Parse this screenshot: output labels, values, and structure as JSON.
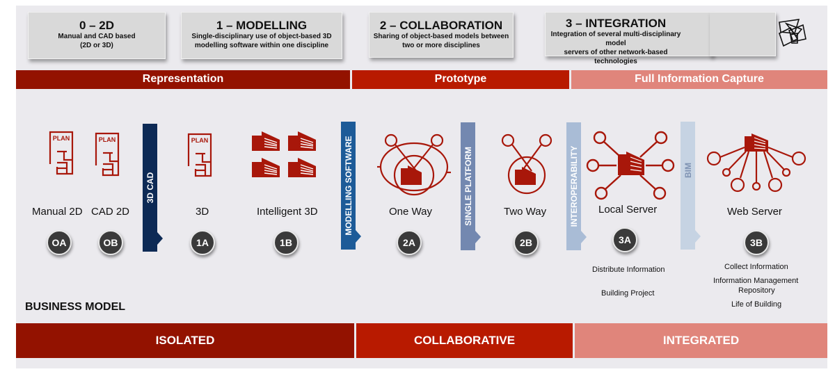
{
  "stages": [
    {
      "title": "0 – 2D",
      "desc1": "Manual and CAD based",
      "desc2": "(2D or 3D)"
    },
    {
      "title": "1 – MODELLING",
      "desc1": "Single-disciplinary use of object-based 3D",
      "desc2": "modelling software within one discipline"
    },
    {
      "title": "2 – COLLABORATION",
      "desc1": "Sharing of object-based models between",
      "desc2": "two or more disciplines"
    },
    {
      "title": "3 – INTEGRATION",
      "desc1": "Integration of several multi-disciplinary model",
      "desc2": "servers of other network-based technologies"
    }
  ],
  "top_bands": [
    "Representation",
    "Prototype",
    "Full Information Capture"
  ],
  "bottom_bands": [
    "ISOLATED",
    "COLLABORATIVE",
    "INTEGRATED"
  ],
  "business_model_label": "BUSINESS MODEL",
  "transitions": [
    "3D CAD",
    "MODELLING SOFTWARE",
    "SINGLE PLATFORM",
    "INTEROPERABILITY",
    "BIM"
  ],
  "steps": [
    {
      "label": "Manual 2D",
      "badge": "OA",
      "icon": "plan-icon"
    },
    {
      "label": "CAD 2D",
      "badge": "OB",
      "icon": "plan-icon"
    },
    {
      "label": "3D",
      "badge": "1A",
      "icon": "plan-icon"
    },
    {
      "label": "Intelligent 3D",
      "badge": "1B",
      "icon": "building-blocks-icon"
    },
    {
      "label": "One Way",
      "badge": "2A",
      "icon": "one-way-collaboration-icon"
    },
    {
      "label": "Two Way",
      "badge": "2B",
      "icon": "two-way-collaboration-icon"
    },
    {
      "label": "Local Server",
      "badge": "3A",
      "icon": "local-server-network-icon"
    },
    {
      "label": "Web Server",
      "badge": "3B",
      "icon": "web-server-network-icon"
    }
  ],
  "plan_text": "PLAN",
  "local_server_notes": [
    "Distribute Information",
    "Building Project"
  ],
  "web_server_notes": [
    "Collect Information",
    "Information Management",
    "Repository",
    "Life of Building"
  ],
  "colors": {
    "dark_red": "#931200",
    "red": "#b81a00",
    "light_red": "#e0857b",
    "icon_red": "#a8170a",
    "navy": "#0d2a55",
    "blue": "#1d5b98",
    "slate_blue": "#7388b0",
    "light_blue": "#a9bcd6",
    "pale_blue": "#c6d3e3"
  }
}
